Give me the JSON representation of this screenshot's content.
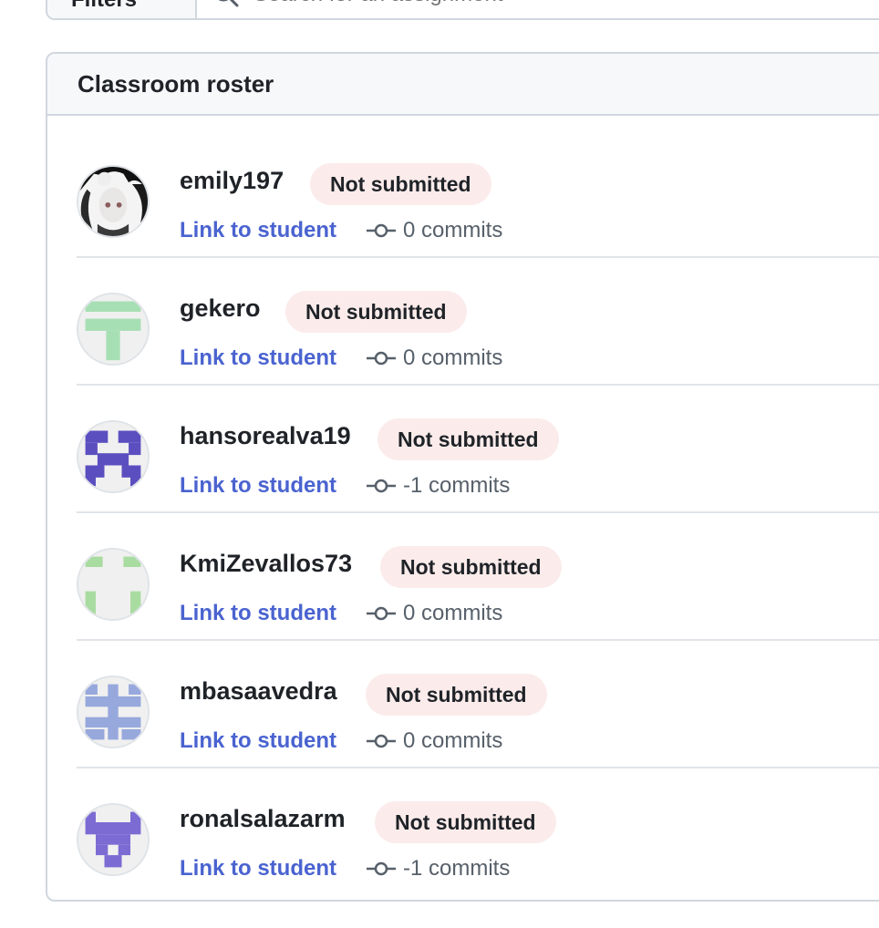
{
  "toolbar": {
    "filters_label": "Filters",
    "search_placeholder": "Search for an assignment"
  },
  "roster": {
    "title": "Classroom roster",
    "students": [
      {
        "username": "emily197",
        "status": "Not submitted",
        "link_label": "Link to student",
        "commits": "0 commits",
        "avatar": "photo-avatar"
      },
      {
        "username": "gekero",
        "status": "Not submitted",
        "link_label": "Link to student",
        "commits": "0 commits",
        "avatar": "identicon-green-t"
      },
      {
        "username": "hansorealva19",
        "status": "Not submitted",
        "link_label": "Link to student",
        "commits": "-1 commits",
        "avatar": "identicon-purple-blocks"
      },
      {
        "username": "KmiZevallos73",
        "status": "Not submitted",
        "link_label": "Link to student",
        "commits": "0 commits",
        "avatar": "identicon-green-brackets"
      },
      {
        "username": "mbasaavedra",
        "status": "Not submitted",
        "link_label": "Link to student",
        "commits": "0 commits",
        "avatar": "identicon-blue-cross"
      },
      {
        "username": "ronalsalazarm",
        "status": "Not submitted",
        "link_label": "Link to student",
        "commits": "-1 commits",
        "avatar": "identicon-violet"
      }
    ]
  },
  "colors": {
    "link": "#4a63d0",
    "badge_bg": "#fbeceb",
    "border": "#d0d7de"
  }
}
